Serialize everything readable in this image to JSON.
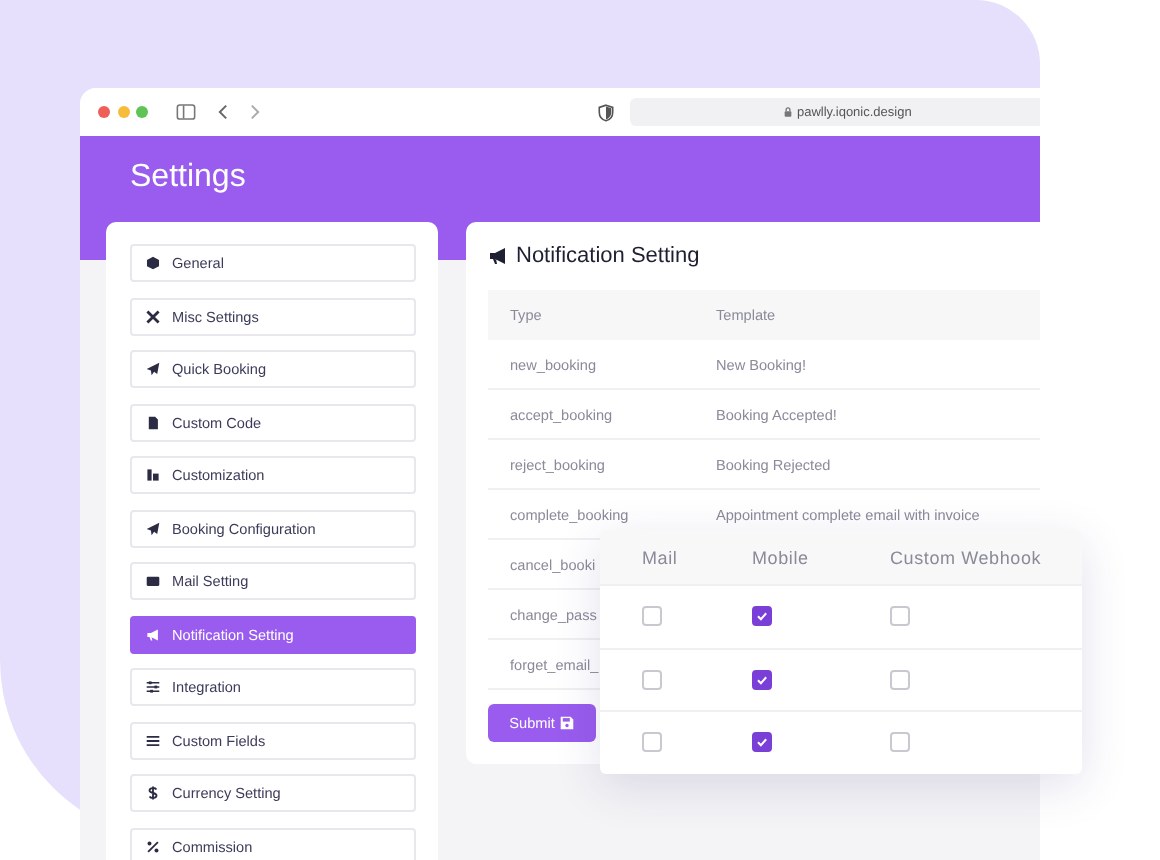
{
  "browser": {
    "url": "pawlly.iqonic.design"
  },
  "page": {
    "title": "Settings"
  },
  "sidebar": {
    "items": [
      {
        "label": "General",
        "selected": false
      },
      {
        "label": "Misc Settings",
        "selected": false
      },
      {
        "label": "Quick Booking",
        "selected": false
      },
      {
        "label": "Custom Code",
        "selected": false
      },
      {
        "label": "Customization",
        "selected": false
      },
      {
        "label": "Booking Configuration",
        "selected": false
      },
      {
        "label": "Mail Setting",
        "selected": false
      },
      {
        "label": "Notification Setting",
        "selected": true
      },
      {
        "label": "Integration",
        "selected": false
      },
      {
        "label": "Custom Fields",
        "selected": false
      },
      {
        "label": "Currency Setting",
        "selected": false
      },
      {
        "label": "Commission",
        "selected": false
      }
    ]
  },
  "panel": {
    "title": "Notification Setting",
    "columns": [
      "Type",
      "Template"
    ],
    "rows": [
      {
        "type": "new_booking",
        "template": "New Booking!"
      },
      {
        "type": "accept_booking",
        "template": "Booking Accepted!"
      },
      {
        "type": "reject_booking",
        "template": "Booking Rejected"
      },
      {
        "type": "complete_booking",
        "template": "Appointment complete email with invoice"
      },
      {
        "type": "cancel_booki"
      },
      {
        "type": "change_pass"
      },
      {
        "type": "forget_email_"
      }
    ],
    "submit": "Submit"
  },
  "channels": {
    "columns": [
      "Mail",
      "Mobile",
      "Custom Webhook"
    ],
    "rows": [
      {
        "mail": false,
        "mobile": true,
        "webhook": false
      },
      {
        "mail": false,
        "mobile": true,
        "webhook": false
      },
      {
        "mail": false,
        "mobile": true,
        "webhook": false
      }
    ]
  }
}
